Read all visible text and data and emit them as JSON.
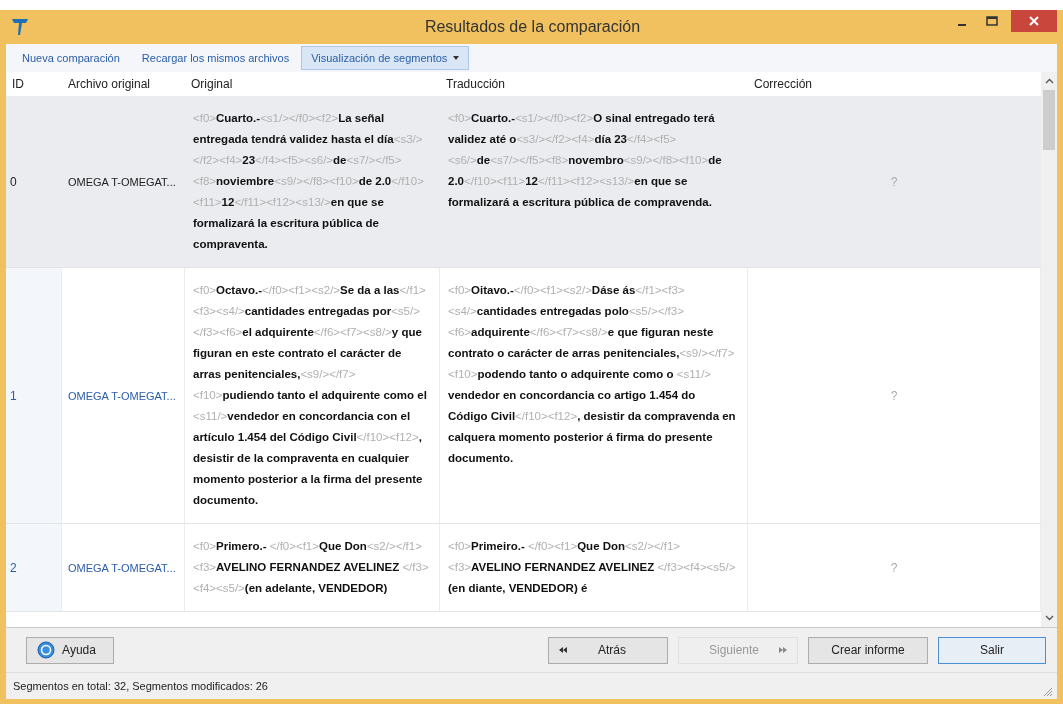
{
  "window": {
    "title": "Resultados de la comparación"
  },
  "toolbar": [
    {
      "label": "Nueva comparación",
      "kind": "link",
      "selected": false
    },
    {
      "label": "Recargar los mismos archivos",
      "kind": "link",
      "selected": false
    },
    {
      "label": "Visualización de segmentos",
      "kind": "dropdown",
      "selected": true
    }
  ],
  "table": {
    "columns": [
      "ID",
      "Archivo original",
      "Original",
      "Traducción",
      "Corrección"
    ],
    "rows": [
      {
        "id": "0",
        "file": "OMEGA T-OMEGAT...",
        "selected": true,
        "original": "<f0>**Cuarto.-**<s1/></f0><f2>**La señal entregada tendrá validez hasta el día**<s3/></f2><f4>**23**</f4><f5><s6/>**de**<s7/></f5><f8>**noviembre**<s9/></f8><f10>**de 2.0**</f10><f11>**12**</f11><f12><s13/>**en que se formalizará la escritura pública de compraventa.**",
        "translation": "<f0>**Cuarto.-**<s1/></f0><f2>**O sinal entregado terá validez até o**<s3/></f2><f4>**día 23**</f4><f5><s6/>**de**<s7/></f5><f8>**novembro**<s9/></f8><f10>**de 2.0**</f10><f11>**12**</f11><f12><s13/>**en que se formalizará a escritura pública de compravenda.**",
        "correction": "?"
      },
      {
        "id": "1",
        "file": "OMEGA T-OMEGAT...",
        "selected": false,
        "original": "<f0>**Octavo.-**</f0><f1><s2/>**Se da a las**</f1><f3><s4/>**cantidades entregadas por**<s5/></f3><f6>**el adquirente**</f6><f7><s8/>**y que figuran en este contrato el carácter de arras penitenciales,**<s9/></f7><f10>**pudiendo tanto el adquirente como el** <s11/>**vendedor en concordancia con el artículo 1.454 del Código Civil**</f10><f12>**, desistir de la compraventa en cualquier momento posterior a la firma del presente documento.**",
        "translation": "<f0>**Oitavo.-**</f0><f1><s2/>**Dáse ás**</f1><f3><s4/>**cantidades entregadas polo**<s5/></f3><f6>**adquirente**</f6><f7><s8/>**e que figuran neste contrato o carácter de arras penitenciales,**<s9/></f7><f10>**podendo tanto o adquirente como o** <s11/> **vendedor en concordancia co artigo 1.454 do Código Civil**</f10><f12>**, desistir da compravenda en calquera momento posterior á firma do presente documento.**",
        "correction": "?"
      },
      {
        "id": "2",
        "file": "OMEGA T-OMEGAT...",
        "selected": false,
        "original": "<f0>**Primero.-** </f0><f1>**Que Don**<s2/></f1><f3>**AVELINO FERNANDEZ AVELINEZ** </f3><f4><s5/>**(en adelante, VENDEDOR)**",
        "translation": "<f0>**Primeiro.-** </f0><f1>**Que Don**<s2/></f1><f3>**AVELINO FERNANDEZ AVELINEZ** </f3><f4><s5/>**(en diante, VENDEDOR) é**",
        "correction": "?"
      }
    ]
  },
  "buttons": [
    {
      "label": "Ayuda",
      "kind": "help",
      "disabled": false,
      "focused": false
    },
    {
      "label": "Atrás",
      "kind": "back",
      "disabled": false,
      "focused": false
    },
    {
      "label": "Siguiente",
      "kind": "next",
      "disabled": true,
      "focused": false
    },
    {
      "label": "Crear informe",
      "kind": "plain",
      "disabled": false,
      "focused": false
    },
    {
      "label": "Salir",
      "kind": "plain",
      "disabled": false,
      "focused": true
    }
  ],
  "status_bar": "Segmentos en total: 32, Segmentos modificados: 26"
}
